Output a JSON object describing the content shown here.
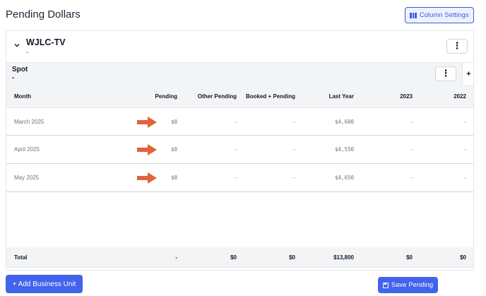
{
  "page": {
    "title": "Pending Dollars",
    "column_settings_label": "Column Settings"
  },
  "business_unit": {
    "name": "WJLC-TV",
    "subtitle": "-",
    "section": {
      "name": "Spot",
      "subtitle": "-",
      "add_label": "+"
    }
  },
  "table": {
    "headers": {
      "month": "Month",
      "pending": "Pending",
      "other_pending": "Other Pending",
      "booked_pending": "Booked + Pending",
      "last_year": "Last Year",
      "y2023": "2023",
      "y2022": "2022"
    },
    "rows": [
      {
        "month": "March 2025",
        "pending": "$0",
        "other_pending": "-",
        "booked_pending": "-",
        "last_year": "$4,600",
        "y2023": "-",
        "y2022": "-"
      },
      {
        "month": "April 2025",
        "pending": "$0",
        "other_pending": "-",
        "booked_pending": "-",
        "last_year": "$4,550",
        "y2023": "-",
        "y2022": "-"
      },
      {
        "month": "May 2025",
        "pending": "$0",
        "other_pending": "-",
        "booked_pending": "-",
        "last_year": "$4,650",
        "y2023": "-",
        "y2022": "-"
      }
    ],
    "total": {
      "label": "Total",
      "pending": "-",
      "other_pending": "$0",
      "booked_pending": "$0",
      "last_year": "$13,800",
      "y2023": "$0",
      "y2022": "$0"
    }
  },
  "actions": {
    "add_business_unit": "+ Add Business Unit",
    "save_pending": "Save Pending"
  },
  "colors": {
    "accent": "#4263eb",
    "annotation_arrow": "#e0643a"
  },
  "icons": [
    "columns-icon",
    "chevron-down-icon",
    "kebab-menu-icon",
    "save-icon",
    "arrow-right-icon"
  ]
}
